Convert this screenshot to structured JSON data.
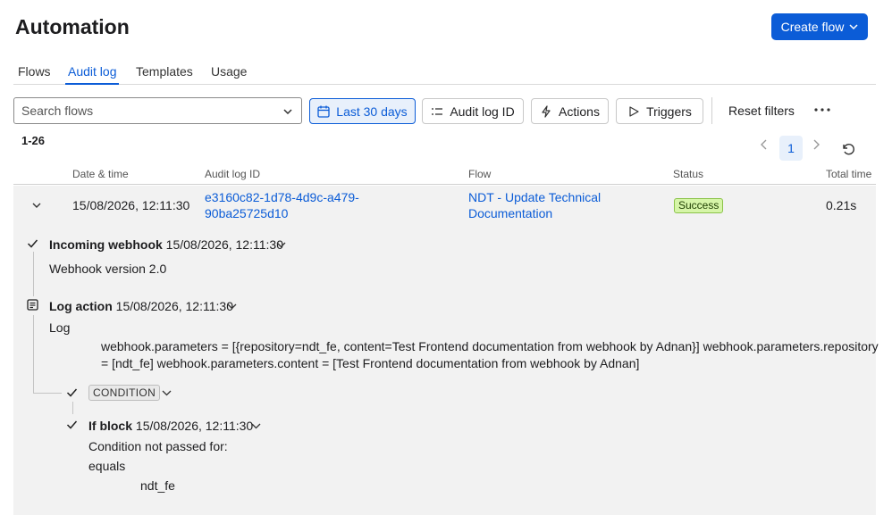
{
  "header": {
    "title": "Automation",
    "create_label": "Create flow"
  },
  "tabs": [
    {
      "label": "Flows"
    },
    {
      "label": "Audit log",
      "active": true
    },
    {
      "label": "Templates"
    },
    {
      "label": "Usage"
    }
  ],
  "filters": {
    "search_placeholder": "Search flows",
    "date_label": "Last 30 days",
    "audit_id_label": "Audit log ID",
    "actions_label": "Actions",
    "triggers_label": "Triggers",
    "reset_label": "Reset filters"
  },
  "pagination": {
    "range": "1-26",
    "current_page": "1"
  },
  "table": {
    "columns": {
      "date": "Date & time",
      "audit_id": "Audit log ID",
      "flow": "Flow",
      "status": "Status",
      "total_time": "Total time"
    },
    "row": {
      "date": "15/08/2026, 12:11:30",
      "audit_id_line1": "e3160c82-1d78-4d9c-a479-",
      "audit_id_line2": "90ba25725d10",
      "flow_line1": "NDT - Update Technical",
      "flow_line2": "Documentation",
      "status": "Success",
      "total_time": "0.21s"
    }
  },
  "steps": {
    "webhook": {
      "label": "Incoming webhook",
      "time": "15/08/2026, 12:11:30",
      "body": "Webhook version 2.0"
    },
    "log": {
      "label": "Log action",
      "time": "15/08/2026, 12:11:30",
      "body": "Log",
      "line1": "webhook.parameters = [{repository=ndt_fe, content=Test Frontend documentation from webhook by Adnan}] webhook.parameters.repository",
      "line2": "= [ndt_fe] webhook.parameters.content = [Test Frontend documentation from webhook by Adnan]"
    },
    "condition": {
      "label": "CONDITION"
    },
    "if_block": {
      "label": "If block",
      "time": "15/08/2026, 12:11:30",
      "body1": "Condition not passed for:",
      "body2": "equals",
      "value": "ndt_fe"
    }
  },
  "colors": {
    "accent": "#0b5cd7",
    "success_bg": "#d6f5a8",
    "detail_bg": "#f2f2f2"
  }
}
